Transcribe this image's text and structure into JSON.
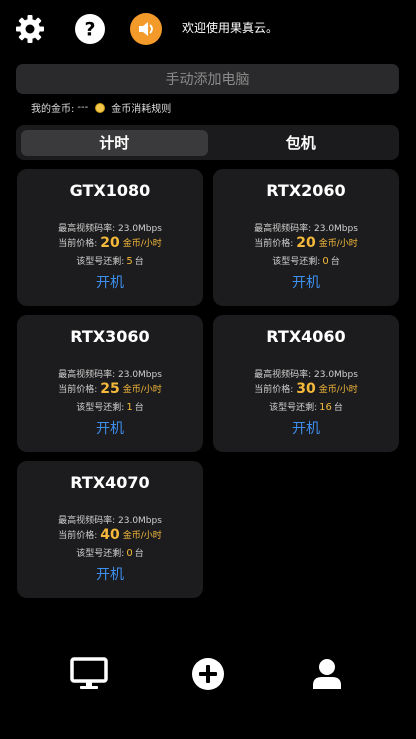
{
  "header": {
    "welcome": "欢迎使用果真云。",
    "icons": [
      "gear-icon",
      "help-icon",
      "speaker-icon"
    ]
  },
  "add_pc": {
    "label": "手动添加电脑"
  },
  "coins": {
    "label": "我的金币:",
    "value": "---",
    "rules_label": "金币消耗规则"
  },
  "tabs": [
    {
      "label": "计时",
      "active": true
    },
    {
      "label": "包机",
      "active": false
    }
  ],
  "cards": [
    {
      "name": "GTX1080",
      "bitrate_label": "最高视频码率:",
      "bitrate": "23.0Mbps",
      "price_label": "当前价格:",
      "price": "20",
      "unit": "金币/小时",
      "remain_label": "该型号还剩:",
      "remain": "5",
      "remain_unit": "台",
      "start": "开机"
    },
    {
      "name": "RTX2060",
      "bitrate_label": "最高视频码率:",
      "bitrate": "23.0Mbps",
      "price_label": "当前价格:",
      "price": "20",
      "unit": "金币/小时",
      "remain_label": "该型号还剩:",
      "remain": "0",
      "remain_unit": "台",
      "start": "开机"
    },
    {
      "name": "RTX3060",
      "bitrate_label": "最高视频码率:",
      "bitrate": "23.0Mbps",
      "price_label": "当前价格:",
      "price": "25",
      "unit": "金币/小时",
      "remain_label": "该型号还剩:",
      "remain": "1",
      "remain_unit": "台",
      "start": "开机"
    },
    {
      "name": "RTX4060",
      "bitrate_label": "最高视频码率:",
      "bitrate": "23.0Mbps",
      "price_label": "当前价格:",
      "price": "30",
      "unit": "金币/小时",
      "remain_label": "该型号还剩:",
      "remain": "16",
      "remain_unit": "台",
      "start": "开机"
    },
    {
      "name": "RTX4070",
      "bitrate_label": "最高视频码率:",
      "bitrate": "23.0Mbps",
      "price_label": "当前价格:",
      "price": "40",
      "unit": "金币/小时",
      "remain_label": "该型号还剩:",
      "remain": "0",
      "remain_unit": "台",
      "start": "开机"
    }
  ],
  "bottom_nav": [
    "monitor-icon",
    "add-icon",
    "user-icon"
  ],
  "colors": {
    "accent": "#f39a2b",
    "price": "#f4b93a",
    "link": "#3d8ff0",
    "card_bg": "#1c1c1e"
  }
}
